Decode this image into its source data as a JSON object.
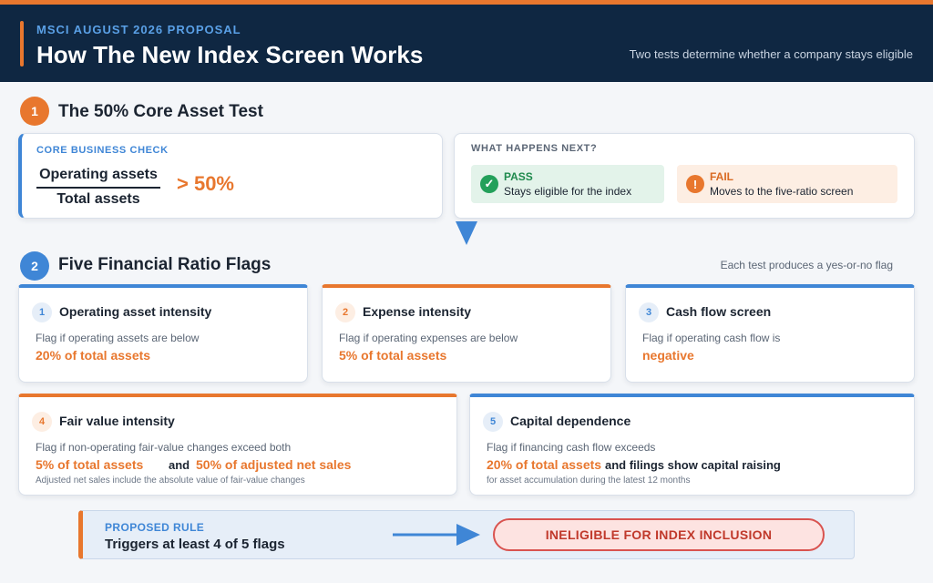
{
  "header": {
    "eyebrow": "MSCI AUGUST 2026 PROPOSAL",
    "title": "How The New Index Screen Works",
    "subtitle": "Two tests determine whether a company stays eligible"
  },
  "step1": {
    "number": "1",
    "title": "The 50% Core Asset Test",
    "core_check": {
      "label": "CORE BUSINESS CHECK",
      "numerator": "Operating assets",
      "denominator": "Total assets",
      "comparison": "> 50%"
    },
    "next": {
      "label": "WHAT HAPPENS NEXT?",
      "pass_title": "PASS",
      "pass_desc": "Stays eligible for the index",
      "fail_title": "FAIL",
      "fail_desc": "Moves to the five-ratio screen"
    }
  },
  "step2": {
    "number": "2",
    "title": "Five Financial Ratio Flags",
    "note": "Each test produces a yes-or-no flag",
    "flags": [
      {
        "number": "1",
        "title": "Operating asset intensity",
        "desc": "Flag if operating assets are below",
        "value": "20% of total assets"
      },
      {
        "number": "2",
        "title": "Expense intensity",
        "desc": "Flag if operating expenses are below",
        "value": "5% of total assets"
      },
      {
        "number": "3",
        "title": "Cash flow screen",
        "desc": "Flag if operating cash flow is",
        "value": "negative"
      },
      {
        "number": "4",
        "title": "Fair value intensity",
        "desc": "Flag if non-operating fair-value changes exceed both",
        "value": "5% of total assets",
        "connector": "and",
        "value2": "50% of adjusted net sales",
        "footnote": "Adjusted net sales include the absolute value of fair-value changes"
      },
      {
        "number": "5",
        "title": "Capital dependence",
        "desc": "Flag if financing cash flow exceeds",
        "value": "20% of total assets",
        "connector": "and filings show capital raising",
        "footnote": "for asset accumulation during the latest 12 months"
      }
    ]
  },
  "rule": {
    "label": "PROPOSED RULE",
    "text": "Triggers at least 4 of 5 flags",
    "verdict": "INELIGIBLE FOR INDEX INCLUSION"
  },
  "colors": {
    "navy": "#0f2742",
    "orange": "#e8772e",
    "blue": "#3f86d6",
    "green": "#23a05a",
    "red": "#c0392b"
  },
  "icons": {
    "pass": "check-circle-icon",
    "fail": "exclamation-circle-icon",
    "flow": "arrow-down-icon",
    "rule": "arrow-right-icon"
  }
}
